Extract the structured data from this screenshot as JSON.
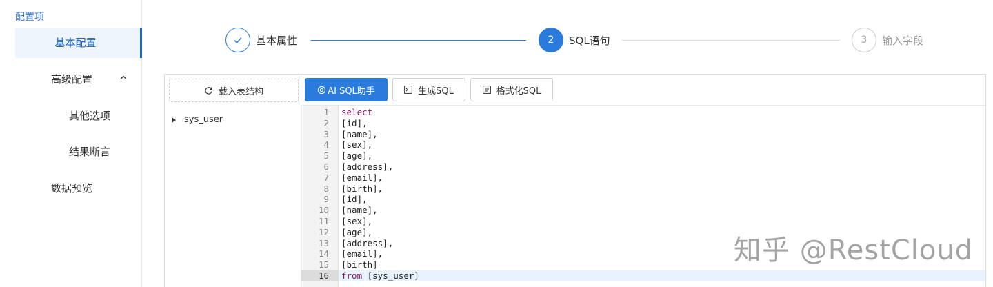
{
  "sidebar": {
    "title": "配置项",
    "items": [
      {
        "label": "基本配置"
      },
      {
        "label": "高级配置"
      },
      {
        "label": "其他选项"
      },
      {
        "label": "结果断言"
      },
      {
        "label": "数据预览"
      }
    ]
  },
  "steps": [
    {
      "label": "基本属性",
      "status": "done"
    },
    {
      "number": "2",
      "label": "SQL语句",
      "status": "active"
    },
    {
      "number": "3",
      "label": "输入字段",
      "status": "pending"
    }
  ],
  "left_pane": {
    "load_button": "载入表结构",
    "tree": [
      {
        "label": "sys_user"
      }
    ]
  },
  "toolbar": {
    "ai_button": "AI SQL助手",
    "generate_button": "生成SQL",
    "format_button": "格式化SQL"
  },
  "editor": {
    "lines": [
      {
        "n": "1",
        "text": "select"
      },
      {
        "n": "2",
        "text": "[id],"
      },
      {
        "n": "3",
        "text": "[name],"
      },
      {
        "n": "4",
        "text": "[sex],"
      },
      {
        "n": "5",
        "text": "[age],"
      },
      {
        "n": "6",
        "text": "[address],"
      },
      {
        "n": "7",
        "text": "[email],"
      },
      {
        "n": "8",
        "text": "[birth],"
      },
      {
        "n": "9",
        "text": "[id],"
      },
      {
        "n": "10",
        "text": "[name],"
      },
      {
        "n": "11",
        "text": "[sex],"
      },
      {
        "n": "12",
        "text": "[age],"
      },
      {
        "n": "13",
        "text": "[address],"
      },
      {
        "n": "14",
        "text": "[email],"
      },
      {
        "n": "15",
        "text": "[birth]"
      },
      {
        "n": "16",
        "text": "from [sys_user]"
      }
    ],
    "active_line": 16
  },
  "watermark": "知乎 @RestCloud",
  "colors": {
    "primary": "#2b7bdc",
    "active_text": "#1e63c8",
    "keyword": "#8a1a6e"
  }
}
